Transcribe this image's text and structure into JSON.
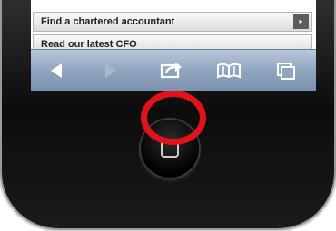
{
  "page": {
    "menu_items": [
      {
        "label": "Find a chartered accountant"
      },
      {
        "label": "Read our latest CFO"
      }
    ],
    "menu_arrow": "▸",
    "toolbar": {
      "icons": [
        "back-icon",
        "forward-icon",
        "share-icon",
        "bookmarks-icon",
        "tabs-icon"
      ]
    },
    "highlight_color": "#e1121a",
    "toolbar_color": "#8fa5bf"
  }
}
